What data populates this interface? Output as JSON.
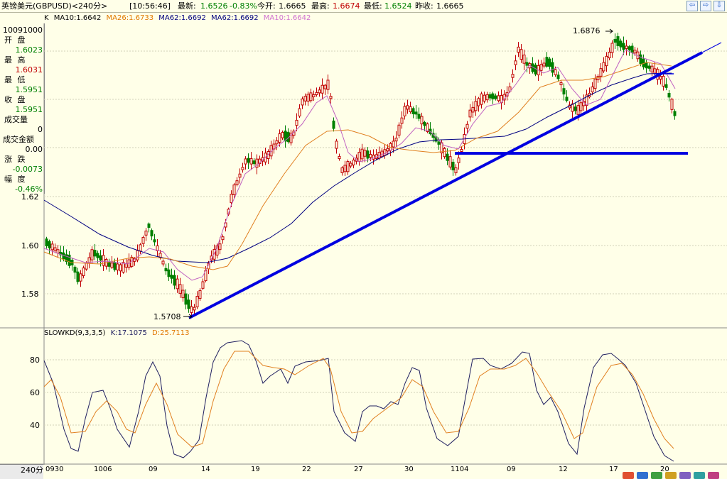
{
  "header": {
    "instrument": "英镑美元(GBPUSD)<240分>",
    "time": "[10:56:46]",
    "latest_label": "最新:",
    "latest_value": "1.6526",
    "change_pct": "-0.83%",
    "open_label": "今开:",
    "open_value": "1.6665",
    "high_label": "最高:",
    "high_value": "1.6674",
    "low_label": "最低:",
    "low_value": "1.6524",
    "prev_close_label": "昨收:",
    "prev_close_value": "1.6665",
    "nav_buttons": [
      "⇦",
      "⇨",
      "⇩"
    ]
  },
  "ma_legend": [
    {
      "text": "K",
      "color": "#000000"
    },
    {
      "text": "MA10:1.6642",
      "color": "#000000"
    },
    {
      "text": "MA26:1.6733",
      "color": "#e07800"
    },
    {
      "text": "MA62:1.6692",
      "color": "#000080"
    },
    {
      "text": "MA62:1.6692",
      "color": "#000080"
    },
    {
      "text": "MA10:1.6642",
      "color": "#d070d0"
    }
  ],
  "info_panel": {
    "date": "10091000",
    "open_label": "开 盘",
    "open": "1.6023",
    "high_label": "最 高",
    "high": "1.6031",
    "low_label": "最 低",
    "low": "1.5951",
    "close_label": "收 盘",
    "close": "1.5951",
    "volume_label": "成交量",
    "volume": "0",
    "amount_label": "成交金额",
    "amount": "0.00",
    "change_label": "涨 跌",
    "change": "-0.0073",
    "range_label": "幅 度",
    "range": "-0.46%"
  },
  "price_axis": [
    "1.62",
    "1.60",
    "1.58"
  ],
  "annotations": {
    "peak": "1.6876",
    "trough": "1.5708"
  },
  "indicator": {
    "title": "SLOWKD(9,3,3,5)",
    "k": "K:17.1075",
    "d": "D:25.7113",
    "axis": [
      "80",
      "60",
      "40"
    ]
  },
  "time_axis": [
    "0930",
    "1006",
    "09",
    "14",
    "19",
    "22",
    "27",
    "30",
    "1104",
    "09",
    "12",
    "17",
    "20"
  ],
  "period_tab": "240分",
  "colors": {
    "up": "#c00000",
    "down": "#008000",
    "trend": "#0000e0"
  }
}
